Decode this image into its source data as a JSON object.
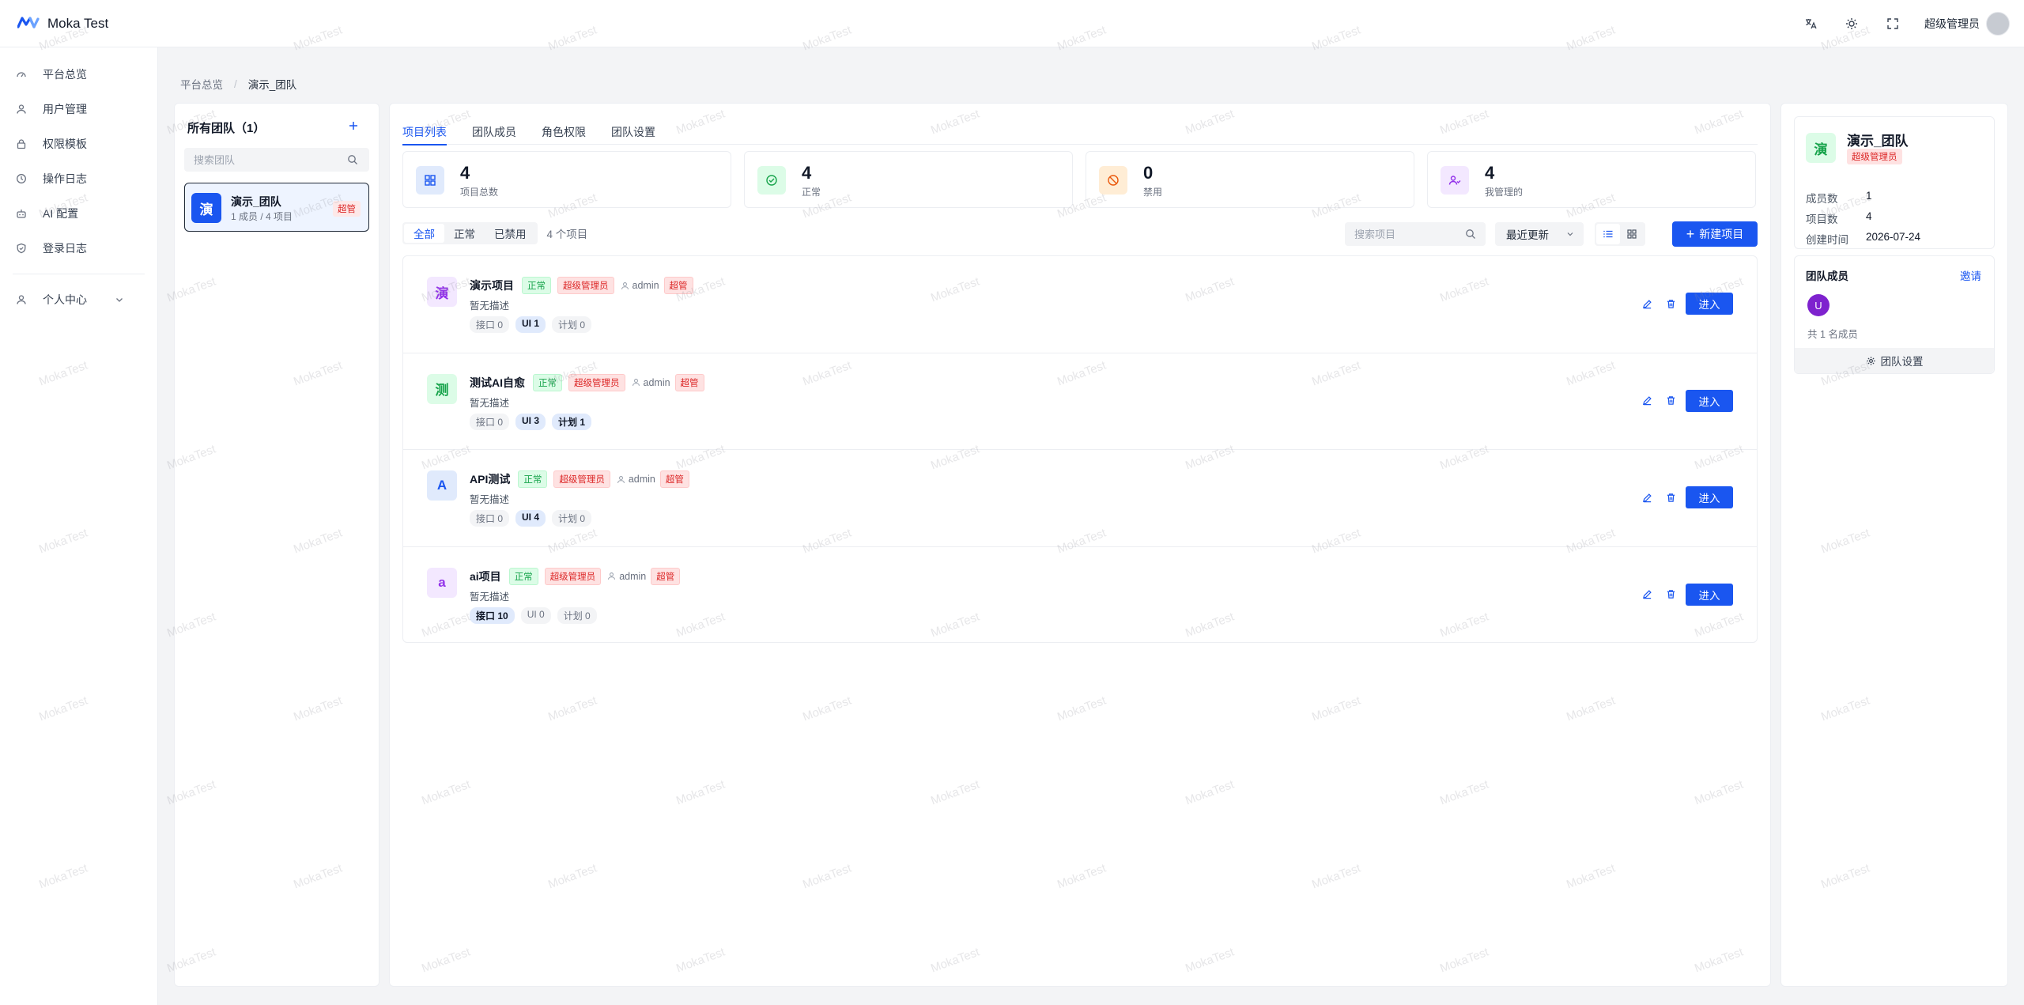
{
  "app": {
    "title": "Moka Test",
    "user_name": "超级管理员",
    "watermark": "MokaTest"
  },
  "sidebar": {
    "items": [
      {
        "label": "平台总览",
        "icon": "dashboard-icon"
      },
      {
        "label": "用户管理",
        "icon": "user-icon"
      },
      {
        "label": "权限模板",
        "icon": "lock-icon"
      },
      {
        "label": "操作日志",
        "icon": "clock-icon"
      },
      {
        "label": "AI 配置",
        "icon": "robot-icon"
      },
      {
        "label": "登录日志",
        "icon": "shield-icon"
      }
    ],
    "personal_center": "个人中心"
  },
  "breadcrumb": {
    "root": "平台总览",
    "current": "演示_团队"
  },
  "teams": {
    "header": "所有团队（1）",
    "search_placeholder": "搜索团队",
    "list": [
      {
        "avatar": "演",
        "name": "演示_团队",
        "meta": "1 成员 / 4 项目",
        "tag": "超管"
      }
    ]
  },
  "tabs": [
    "项目列表",
    "团队成员",
    "角色权限",
    "团队设置"
  ],
  "stats": [
    {
      "value": "4",
      "label": "项目总数",
      "icon": "grid-icon"
    },
    {
      "value": "4",
      "label": "正常",
      "icon": "check-circle-icon"
    },
    {
      "value": "0",
      "label": "禁用",
      "icon": "ban-icon"
    },
    {
      "value": "4",
      "label": "我管理的",
      "icon": "users-icon"
    }
  ],
  "filters": {
    "options": [
      "全部",
      "正常",
      "已禁用"
    ],
    "selected": "全部",
    "count": "4 个项目",
    "search_placeholder": "搜索项目",
    "sort": "最近更新",
    "new_button": "新建项目"
  },
  "projects": [
    {
      "avatar": "演",
      "name": "演示项目",
      "status": "正常",
      "role": "超级管理员",
      "owner": "admin",
      "owner_tag": "超管",
      "desc": "暂无描述",
      "stats": [
        "接口 0",
        "UI 1",
        "计划 0"
      ],
      "enter": "进入"
    },
    {
      "avatar": "测",
      "name": "测试AI自愈",
      "status": "正常",
      "role": "超级管理员",
      "owner": "admin",
      "owner_tag": "超管",
      "desc": "暂无描述",
      "stats": [
        "接口 0",
        "UI 3",
        "计划 1"
      ],
      "enter": "进入"
    },
    {
      "avatar": "A",
      "name": "API测试",
      "status": "正常",
      "role": "超级管理员",
      "owner": "admin",
      "owner_tag": "超管",
      "desc": "暂无描述",
      "stats": [
        "接口 0",
        "UI 4",
        "计划 0"
      ],
      "enter": "进入"
    },
    {
      "avatar": "a",
      "name": "ai项目",
      "status": "正常",
      "role": "超级管理员",
      "owner": "admin",
      "owner_tag": "超管",
      "desc": "暂无描述",
      "stats": [
        "接口 10",
        "UI 0",
        "计划 0"
      ],
      "enter": "进入"
    }
  ],
  "team_info": {
    "avatar": "演",
    "name": "演示_团队",
    "tag": "超级管理员",
    "rows": [
      {
        "key": "成员数",
        "value": "1"
      },
      {
        "key": "项目数",
        "value": "4"
      },
      {
        "key": "创建时间",
        "value": "2026-07-24"
      }
    ]
  },
  "members": {
    "title": "团队成员",
    "invite": "邀请",
    "avatar": "U",
    "count": "共 1 名成员",
    "settings": "团队设置"
  },
  "colors": {
    "primary": "#1a56f0",
    "success": "#16a34a",
    "danger": "#dc2626"
  }
}
